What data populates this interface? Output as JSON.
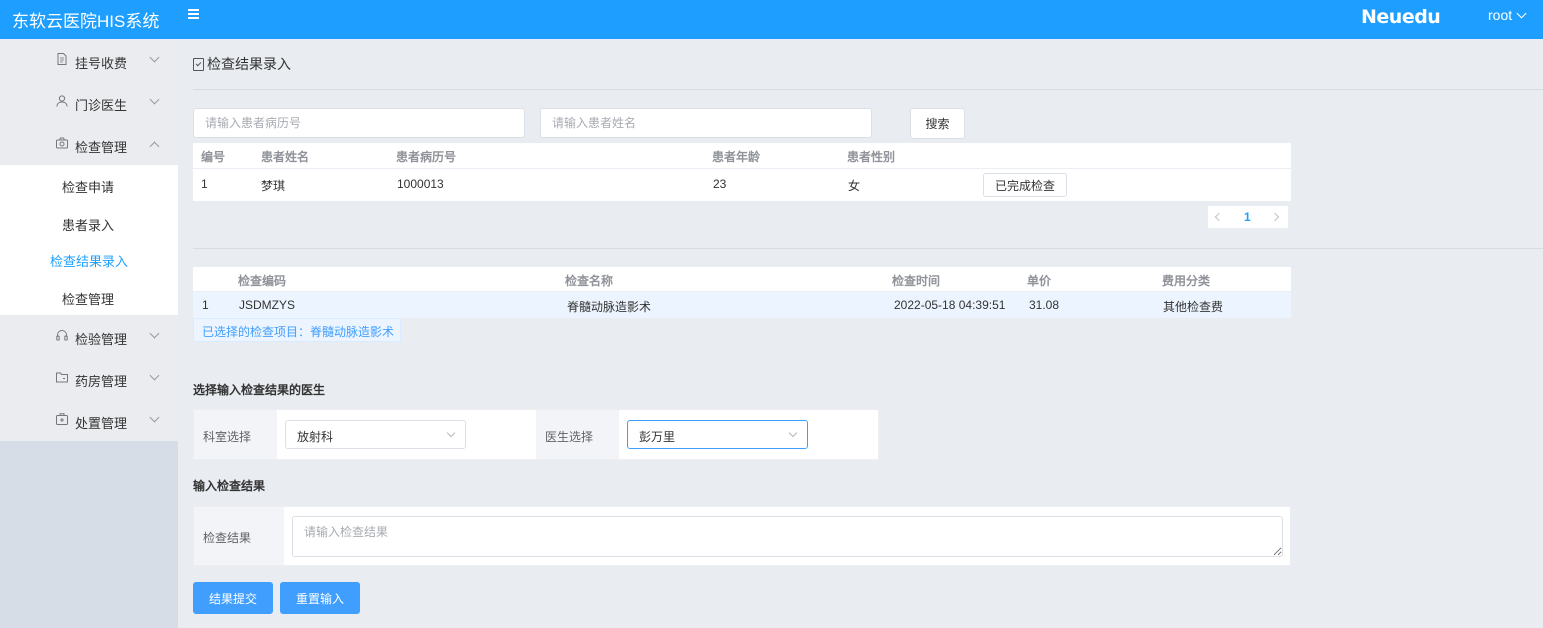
{
  "header": {
    "app_title": "东软云医院HIS系统",
    "brand": "Neuedu",
    "user": "root",
    "brand_color": "#1e9fff"
  },
  "sidebar": {
    "items": [
      {
        "label": "挂号收费",
        "icon": "document-icon",
        "expanded": false
      },
      {
        "label": "门诊医生",
        "icon": "user-icon",
        "expanded": false
      },
      {
        "label": "检查管理",
        "icon": "camera-icon",
        "expanded": true
      },
      {
        "label": "检验管理",
        "icon": "headset-icon",
        "expanded": false
      },
      {
        "label": "药房管理",
        "icon": "folder-icon",
        "expanded": false
      },
      {
        "label": "处置管理",
        "icon": "medical-box-icon",
        "expanded": false
      }
    ],
    "submenu": [
      {
        "label": "检查申请",
        "active": false
      },
      {
        "label": "患者录入",
        "active": false
      },
      {
        "label": "检查结果录入",
        "active": true
      },
      {
        "label": "检查管理",
        "active": false
      }
    ]
  },
  "page": {
    "title": "检查结果录入"
  },
  "search": {
    "record_placeholder": "请输入患者病历号",
    "name_placeholder": "请输入患者姓名",
    "button": "搜索"
  },
  "patients": {
    "columns": [
      "编号",
      "患者姓名",
      "患者病历号",
      "患者年龄",
      "患者性别"
    ],
    "rows": [
      {
        "id": "1",
        "name": "梦琪",
        "record": "1000013",
        "age": "23",
        "gender": "女",
        "action": "已完成检查"
      }
    ]
  },
  "pagination": {
    "current": "1"
  },
  "exams": {
    "columns": [
      "检查编码",
      "检查名称",
      "检查时间",
      "单价",
      "费用分类"
    ],
    "rows": [
      {
        "index": "1",
        "code": "JSDMZYS",
        "name": "脊髓动脉造影术",
        "time": "2022-05-18 04:39:51",
        "price": "31.08",
        "category": "其他检查费"
      }
    ],
    "selected_note": "已选择的检查项目：脊髓动脉造影术"
  },
  "doctor_section": {
    "title": "选择输入检查结果的医生",
    "dept_label": "科室选择",
    "dept_value": "放射科",
    "doctor_label": "医生选择",
    "doctor_value": "彭万里"
  },
  "result_section": {
    "title": "输入检查结果",
    "label": "检查结果",
    "placeholder": "请输入检查结果"
  },
  "actions": {
    "submit": "结果提交",
    "reset": "重置输入"
  }
}
